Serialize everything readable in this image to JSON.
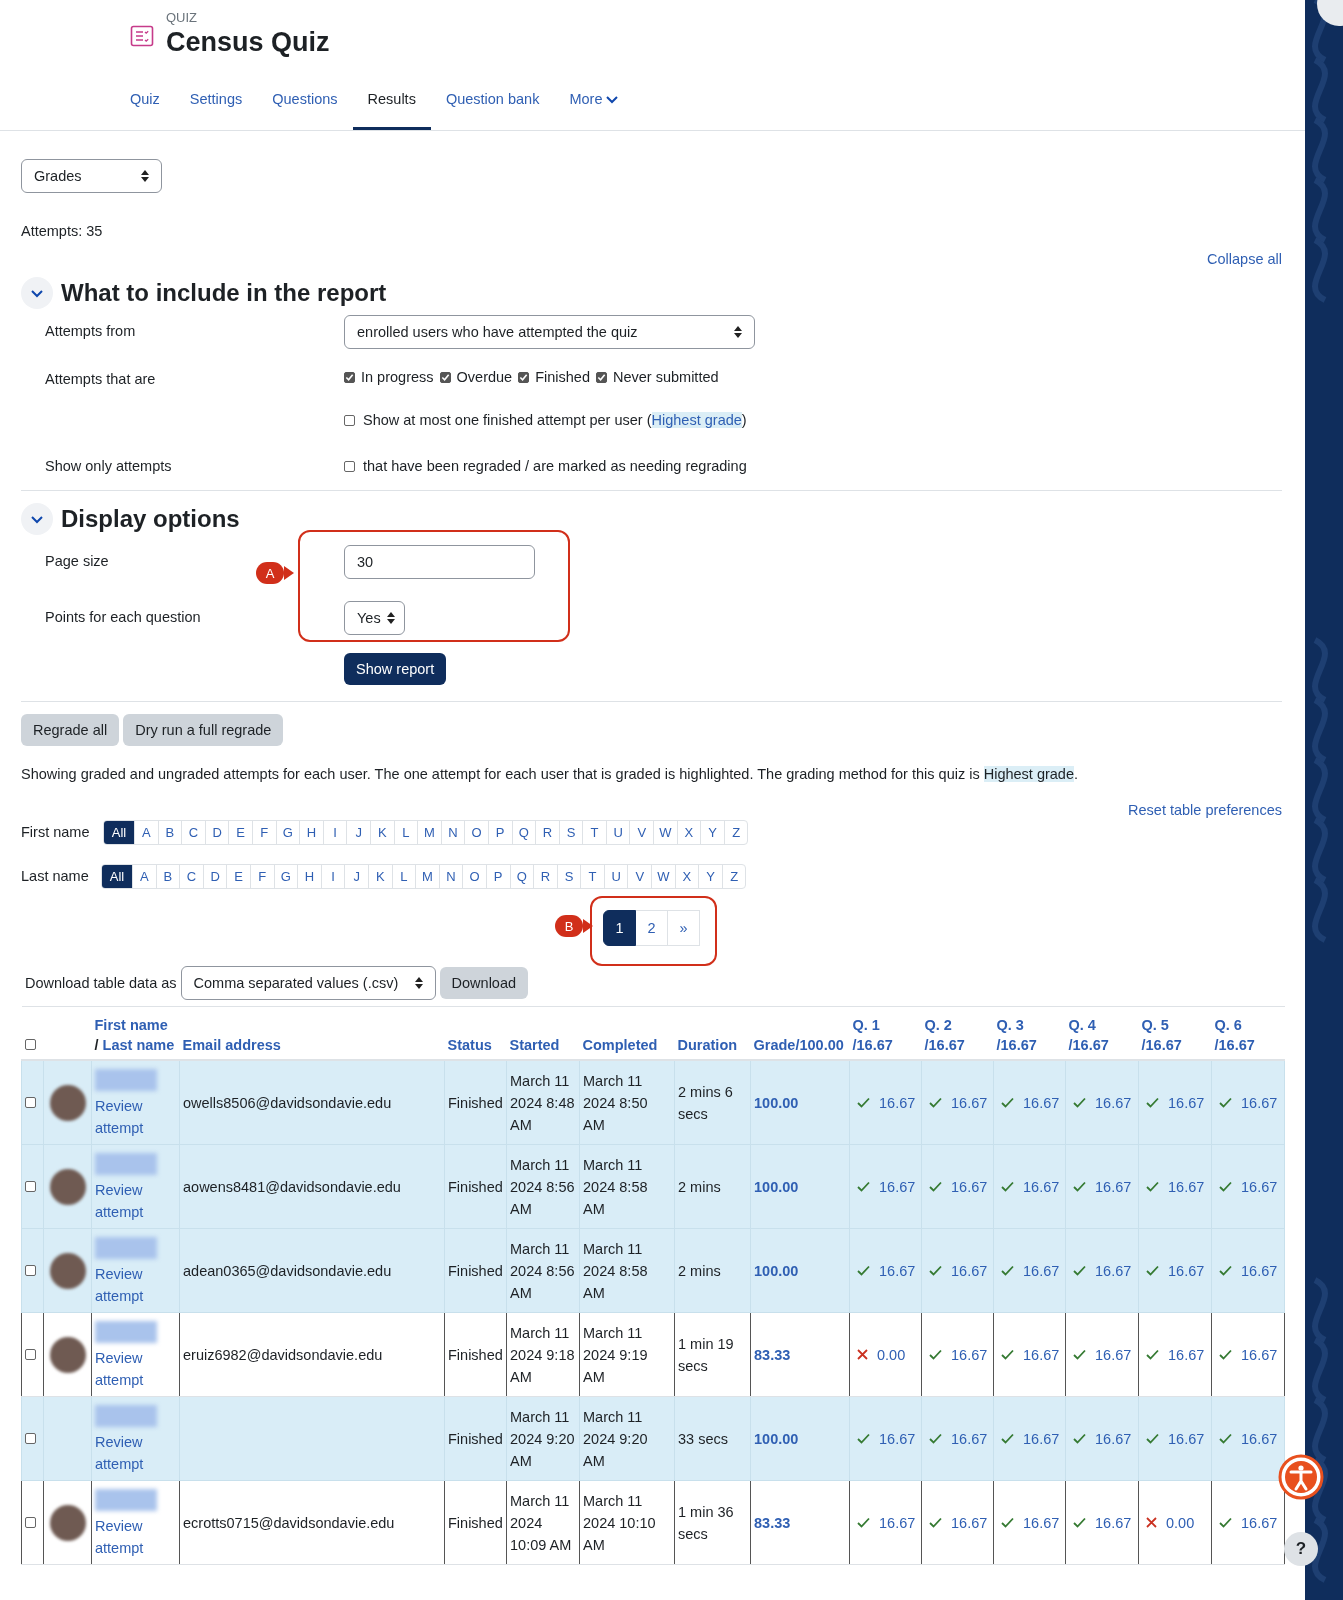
{
  "header": {
    "kicker": "QUIZ",
    "title": "Census Quiz"
  },
  "tabs": [
    {
      "label": "Quiz",
      "selected": false
    },
    {
      "label": "Settings",
      "selected": false
    },
    {
      "label": "Questions",
      "selected": false
    },
    {
      "label": "Results",
      "selected": true
    },
    {
      "label": "Question bank",
      "selected": false
    },
    {
      "label": "More",
      "selected": false,
      "kind": "menu"
    }
  ],
  "report_select": {
    "value": "Grades"
  },
  "attempts_count": "Attempts: 35",
  "collapse_all": "Collapse all",
  "include_section": {
    "title": "What to include in the report",
    "expanded": true,
    "attempts_from": {
      "label": "Attempts from",
      "value": "enrolled users who have attempted the quiz"
    },
    "attempts_that_are": {
      "label": "Attempts that are",
      "options": [
        {
          "label": "In progress",
          "checked": true
        },
        {
          "label": "Overdue",
          "checked": true
        },
        {
          "label": "Finished",
          "checked": true
        },
        {
          "label": "Never submitted",
          "checked": true
        }
      ]
    },
    "one_attempt": {
      "label_before": "Show at most one finished attempt per user (",
      "highlight": "Highest grade",
      "label_after": ")",
      "checked": false
    },
    "show_only": {
      "label": "Show only attempts",
      "option": "that have been regraded / are marked as needing regrading",
      "checked": false
    }
  },
  "display_section": {
    "title": "Display options",
    "expanded": true,
    "page_size": {
      "label": "Page size",
      "value": "30"
    },
    "points": {
      "label": "Points for each question",
      "value": "Yes"
    },
    "submit": "Show report"
  },
  "annotations": [
    {
      "label": "A"
    },
    {
      "label": "B"
    }
  ],
  "regrade_buttons": [
    "Regrade all",
    "Dry run a full regrade"
  ],
  "info": {
    "before": "Showing graded and ungraded attempts for each user. The one attempt for each user that is graded is highlighted. The grading method for this quiz is ",
    "highlight": "Highest grade",
    "after": "."
  },
  "reset_preferences": "Reset table preferences",
  "initials_bars": [
    {
      "label": "First name",
      "letters": [
        {
          "text": "All",
          "selected": true
        },
        {
          "text": "A",
          "selected": false
        },
        {
          "text": "B",
          "selected": false
        },
        {
          "text": "C",
          "selected": false
        },
        {
          "text": "D",
          "selected": false
        },
        {
          "text": "E",
          "selected": false
        },
        {
          "text": "F",
          "selected": false
        },
        {
          "text": "G",
          "selected": false
        },
        {
          "text": "H",
          "selected": false
        },
        {
          "text": "I",
          "selected": false
        },
        {
          "text": "J",
          "selected": false
        },
        {
          "text": "K",
          "selected": false
        },
        {
          "text": "L",
          "selected": false
        },
        {
          "text": "M",
          "selected": false
        },
        {
          "text": "N",
          "selected": false
        },
        {
          "text": "O",
          "selected": false
        },
        {
          "text": "P",
          "selected": false
        },
        {
          "text": "Q",
          "selected": false
        },
        {
          "text": "R",
          "selected": false
        },
        {
          "text": "S",
          "selected": false
        },
        {
          "text": "T",
          "selected": false
        },
        {
          "text": "U",
          "selected": false
        },
        {
          "text": "V",
          "selected": false
        },
        {
          "text": "W",
          "selected": false
        },
        {
          "text": "X",
          "selected": false
        },
        {
          "text": "Y",
          "selected": false
        },
        {
          "text": "Z",
          "selected": false
        }
      ]
    },
    {
      "label": "Last name",
      "letters": [
        {
          "text": "All",
          "selected": true
        },
        {
          "text": "A",
          "selected": false
        },
        {
          "text": "B",
          "selected": false
        },
        {
          "text": "C",
          "selected": false
        },
        {
          "text": "D",
          "selected": false
        },
        {
          "text": "E",
          "selected": false
        },
        {
          "text": "F",
          "selected": false
        },
        {
          "text": "G",
          "selected": false
        },
        {
          "text": "H",
          "selected": false
        },
        {
          "text": "I",
          "selected": false
        },
        {
          "text": "J",
          "selected": false
        },
        {
          "text": "K",
          "selected": false
        },
        {
          "text": "L",
          "selected": false
        },
        {
          "text": "M",
          "selected": false
        },
        {
          "text": "N",
          "selected": false
        },
        {
          "text": "O",
          "selected": false
        },
        {
          "text": "P",
          "selected": false
        },
        {
          "text": "Q",
          "selected": false
        },
        {
          "text": "R",
          "selected": false
        },
        {
          "text": "S",
          "selected": false
        },
        {
          "text": "T",
          "selected": false
        },
        {
          "text": "U",
          "selected": false
        },
        {
          "text": "V",
          "selected": false
        },
        {
          "text": "W",
          "selected": false
        },
        {
          "text": "X",
          "selected": false
        },
        {
          "text": "Y",
          "selected": false
        },
        {
          "text": "Z",
          "selected": false
        }
      ]
    }
  ],
  "pagination": [
    {
      "text": "1",
      "selected": true
    },
    {
      "text": "2",
      "selected": false
    },
    {
      "text": "»",
      "selected": false
    }
  ],
  "download": {
    "label": "Download table data as",
    "format": "Comma separated values (.csv)",
    "button": "Download"
  },
  "table": {
    "select_all_checked": false,
    "first_name": "First name",
    "separator": "/",
    "last_name": "Last name",
    "columns": [
      "Email address",
      "Status",
      "Started",
      "Completed",
      "Duration",
      "Grade/100.00"
    ],
    "questions": [
      {
        "label": "Q. 1",
        "max": "/16.67"
      },
      {
        "label": "Q. 2",
        "max": "/16.67"
      },
      {
        "label": "Q. 3",
        "max": "/16.67"
      },
      {
        "label": "Q. 4",
        "max": "/16.67"
      },
      {
        "label": "Q. 5",
        "max": "/16.67"
      },
      {
        "label": "Q. 6",
        "max": "/16.67"
      }
    ],
    "rows": [
      {
        "highlighted": true,
        "checked": false,
        "avatar": true,
        "review": "Review attempt",
        "email": "owells8506@davidsondavie.edu",
        "status": "Finished",
        "started": "March 11 2024 8:48 AM",
        "completed": "March 11 2024 8:50 AM",
        "duration": "2 mins 6 secs",
        "grade": "100.00",
        "answers": [
          {
            "correct": true,
            "score": "16.67"
          },
          {
            "correct": true,
            "score": "16.67"
          },
          {
            "correct": true,
            "score": "16.67"
          },
          {
            "correct": true,
            "score": "16.67"
          },
          {
            "correct": true,
            "score": "16.67"
          },
          {
            "correct": true,
            "score": "16.67"
          }
        ]
      },
      {
        "highlighted": true,
        "checked": false,
        "avatar": true,
        "review": "Review attempt",
        "email": "aowens8481@davidsondavie.edu",
        "status": "Finished",
        "started": "March 11 2024 8:56 AM",
        "completed": "March 11 2024 8:58 AM",
        "duration": "2 mins",
        "grade": "100.00",
        "answers": [
          {
            "correct": true,
            "score": "16.67"
          },
          {
            "correct": true,
            "score": "16.67"
          },
          {
            "correct": true,
            "score": "16.67"
          },
          {
            "correct": true,
            "score": "16.67"
          },
          {
            "correct": true,
            "score": "16.67"
          },
          {
            "correct": true,
            "score": "16.67"
          }
        ]
      },
      {
        "highlighted": true,
        "checked": false,
        "avatar": true,
        "review": "Review attempt",
        "email": "adean0365@davidsondavie.edu",
        "status": "Finished",
        "started": "March 11 2024 8:56 AM",
        "completed": "March 11 2024 8:58 AM",
        "duration": "2 mins",
        "grade": "100.00",
        "answers": [
          {
            "correct": true,
            "score": "16.67"
          },
          {
            "correct": true,
            "score": "16.67"
          },
          {
            "correct": true,
            "score": "16.67"
          },
          {
            "correct": true,
            "score": "16.67"
          },
          {
            "correct": true,
            "score": "16.67"
          },
          {
            "correct": true,
            "score": "16.67"
          }
        ]
      },
      {
        "highlighted": false,
        "checked": false,
        "avatar": true,
        "review": "Review attempt",
        "email": "eruiz6982@davidsondavie.edu",
        "status": "Finished",
        "started": "March 11 2024 9:18 AM",
        "completed": "March 11 2024 9:19 AM",
        "duration": "1 min 19 secs",
        "grade": "83.33",
        "answers": [
          {
            "correct": false,
            "score": "0.00"
          },
          {
            "correct": true,
            "score": "16.67"
          },
          {
            "correct": true,
            "score": "16.67"
          },
          {
            "correct": true,
            "score": "16.67"
          },
          {
            "correct": true,
            "score": "16.67"
          },
          {
            "correct": true,
            "score": "16.67"
          }
        ]
      },
      {
        "highlighted": true,
        "checked": false,
        "avatar": false,
        "review": "Review attempt",
        "status": "Finished",
        "started": "March 11 2024 9:20 AM",
        "completed": "March 11 2024 9:20 AM",
        "duration": "33 secs",
        "grade": "100.00",
        "answers": [
          {
            "correct": true,
            "score": "16.67"
          },
          {
            "correct": true,
            "score": "16.67"
          },
          {
            "correct": true,
            "score": "16.67"
          },
          {
            "correct": true,
            "score": "16.67"
          },
          {
            "correct": true,
            "score": "16.67"
          },
          {
            "correct": true,
            "score": "16.67"
          }
        ]
      },
      {
        "highlighted": false,
        "checked": false,
        "avatar": true,
        "review": "Review attempt",
        "email": "ecrotts0715@davidsondavie.edu",
        "status": "Finished",
        "started": "March 11 2024 10:09 AM",
        "completed": "March 11 2024 10:10 AM",
        "duration": "1 min 36 secs",
        "grade": "83.33",
        "answers": [
          {
            "correct": true,
            "score": "16.67"
          },
          {
            "correct": true,
            "score": "16.67"
          },
          {
            "correct": true,
            "score": "16.67"
          },
          {
            "correct": true,
            "score": "16.67"
          },
          {
            "correct": false,
            "score": "0.00"
          },
          {
            "correct": true,
            "score": "16.67"
          }
        ]
      }
    ]
  },
  "help_button": "?"
}
